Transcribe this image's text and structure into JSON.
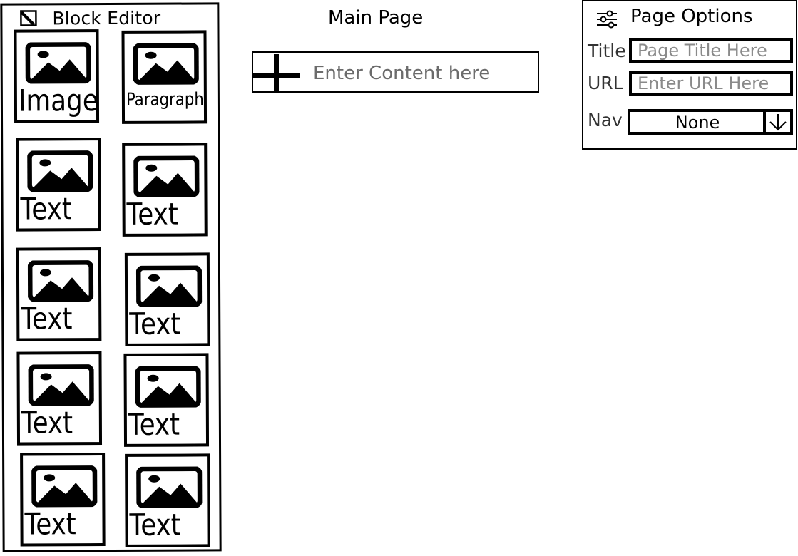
{
  "block_editor": {
    "title": "Block Editor",
    "blocks": [
      {
        "label": "Image"
      },
      {
        "label": "Paragraph"
      },
      {
        "label": "Text"
      },
      {
        "label": "Text"
      },
      {
        "label": "Text"
      },
      {
        "label": "Text"
      },
      {
        "label": "Text"
      },
      {
        "label": "Text"
      },
      {
        "label": "Text"
      },
      {
        "label": "Text"
      }
    ]
  },
  "main_page": {
    "title": "Main Page",
    "content_placeholder": "Enter Content here"
  },
  "page_options": {
    "title": "Page Options",
    "title_label": "Title",
    "title_placeholder": "Page Title Here",
    "url_label": "URL",
    "url_placeholder": "Enter URL Here",
    "nav_label": "Nav",
    "nav_value": "None"
  }
}
